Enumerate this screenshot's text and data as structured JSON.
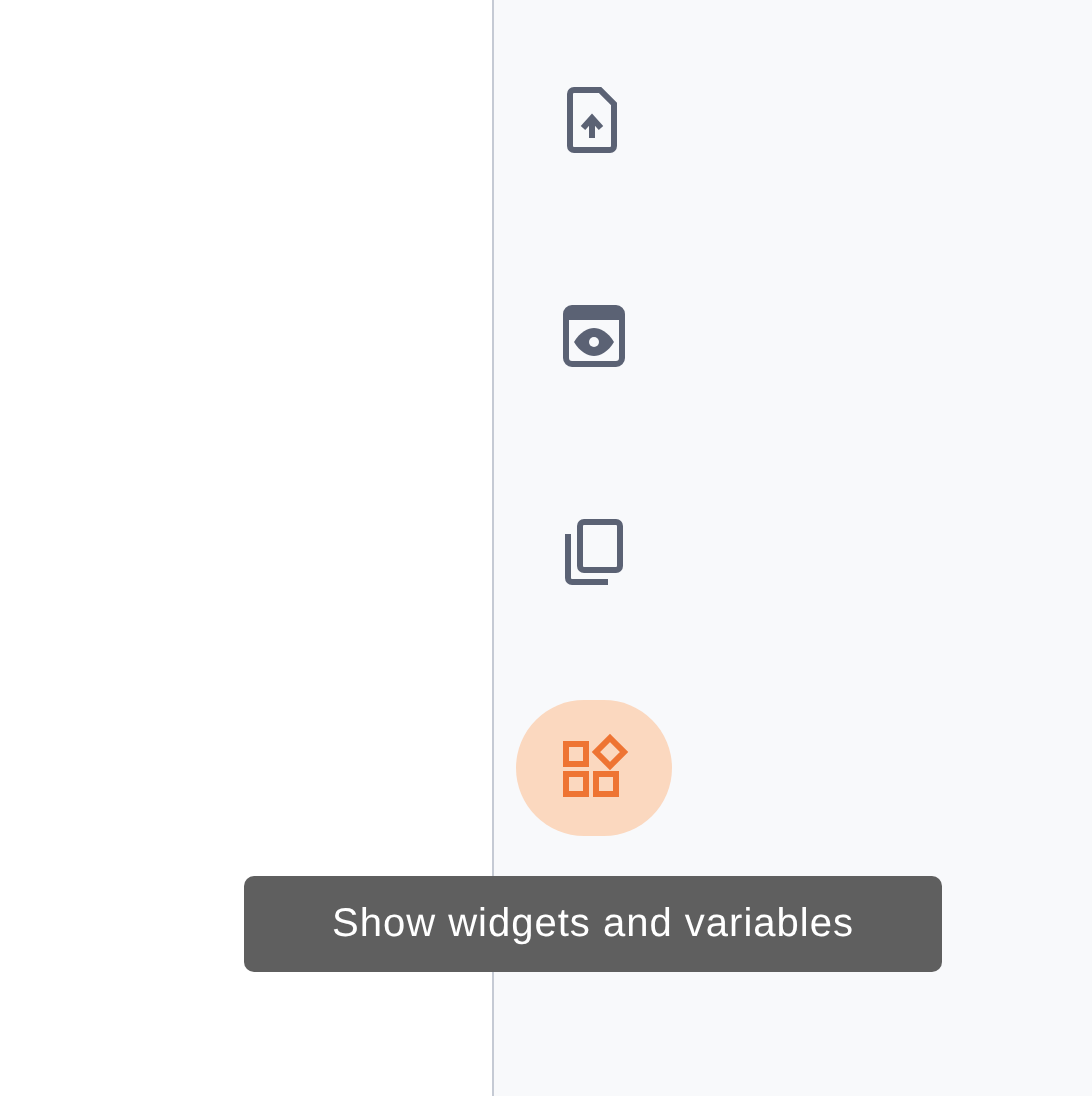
{
  "rail": {
    "items": [
      {
        "kind": "upload",
        "selected": false
      },
      {
        "kind": "preview",
        "selected": false
      },
      {
        "kind": "copy",
        "selected": false
      },
      {
        "kind": "widgets",
        "selected": true
      }
    ]
  },
  "tooltip": {
    "text": "Show widgets and variables"
  }
}
